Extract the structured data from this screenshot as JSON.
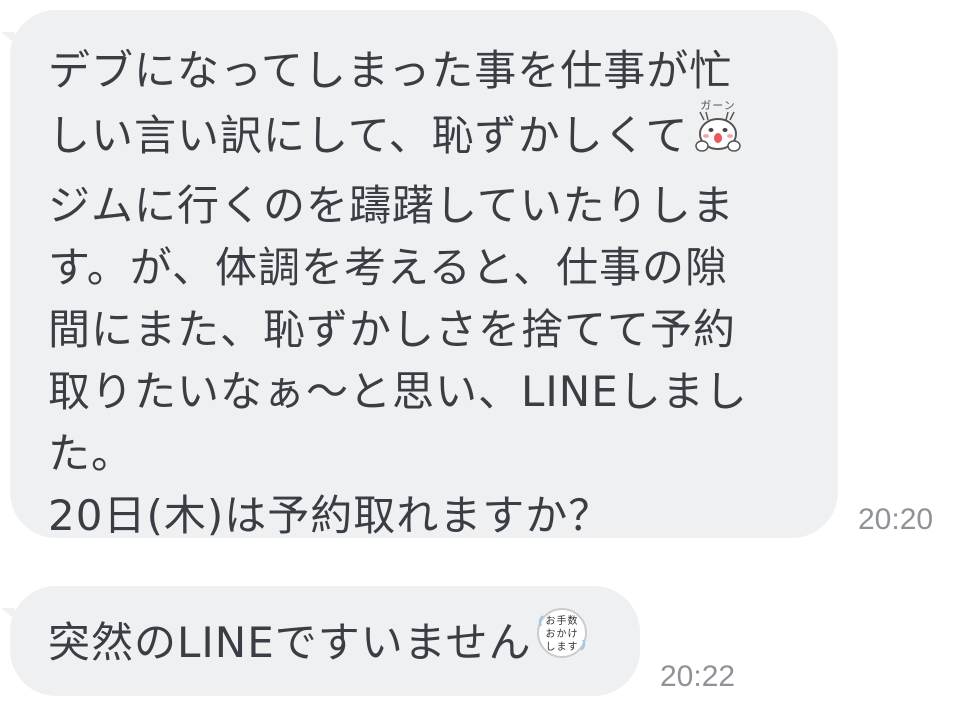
{
  "chat": {
    "messages": [
      {
        "lines": [
          "デブになってしまった事を仕事が忙",
          "しい言い訳にして、恥ずかしくて",
          "ジムに行くのを躊躇していたりしま",
          "す。が、体調を考えると、仕事の隙",
          "間にまた、恥ずかしさを捨てて予約",
          "取りたいなぁ〜と思い、LINEしまし",
          "た。",
          "20日(木)は予約取れますか？"
        ],
        "time": "20:20",
        "emoji": {
          "name": "crying-emoji",
          "caption": "ガーン"
        }
      },
      {
        "text": "突然のLINEですいません",
        "time": "20:22",
        "emoji": {
          "name": "apology-emoji",
          "caption": "お手数おかけします"
        }
      }
    ]
  },
  "colors": {
    "bubble_bg": "#eff0f2",
    "text": "#3b3d44",
    "timestamp": "#8f9398"
  }
}
